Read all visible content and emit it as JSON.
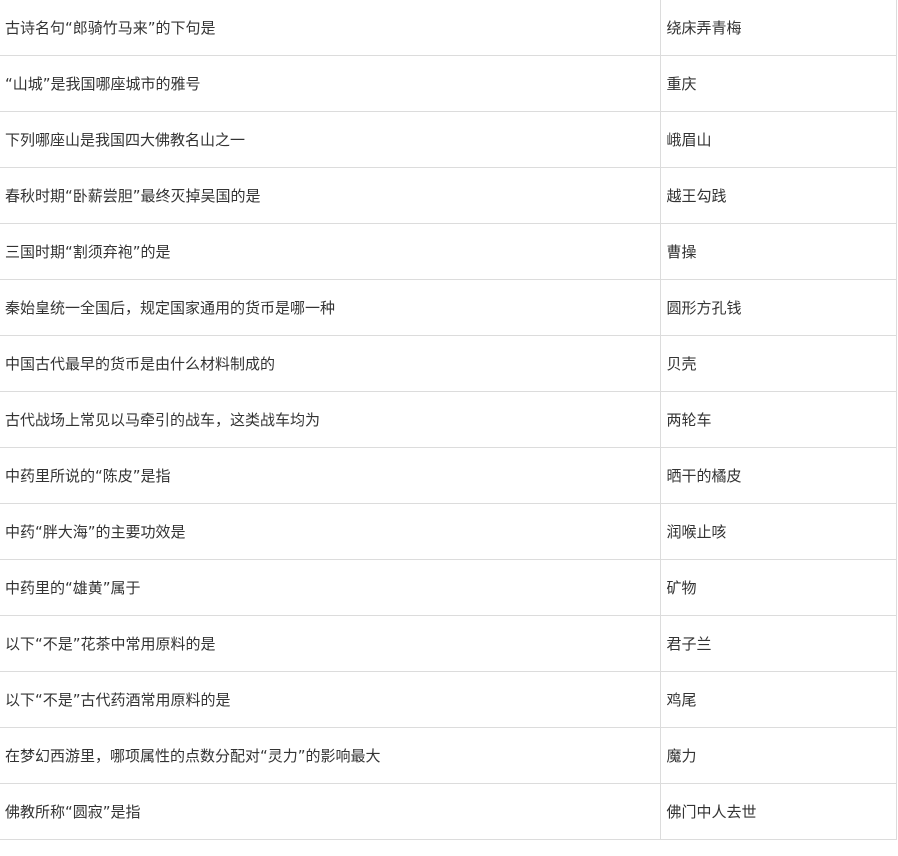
{
  "rows": [
    {
      "question": "古诗名句“郎骑竹马来”的下句是",
      "answer": "绕床弄青梅"
    },
    {
      "question": "“山城”是我国哪座城市的雅号",
      "answer": "重庆"
    },
    {
      "question": "下列哪座山是我国四大佛教名山之一",
      "answer": "峨眉山"
    },
    {
      "question": "春秋时期“卧薪尝胆”最终灭掉吴国的是",
      "answer": "越王勾践"
    },
    {
      "question": "三国时期“割须弃袍”的是",
      "answer": "曹操"
    },
    {
      "question": "秦始皇统一全国后，规定国家通用的货币是哪一种",
      "answer": "圆形方孔钱"
    },
    {
      "question": "中国古代最早的货币是由什么材料制成的",
      "answer": "贝壳"
    },
    {
      "question": "古代战场上常见以马牵引的战车，这类战车均为",
      "answer": "两轮车"
    },
    {
      "question": "中药里所说的“陈皮”是指",
      "answer": "晒干的橘皮"
    },
    {
      "question": "中药“胖大海”的主要功效是",
      "answer": "润喉止咳"
    },
    {
      "question": "中药里的“雄黄”属于",
      "answer": "矿物"
    },
    {
      "question": "以下“不是”花茶中常用原料的是",
      "answer": "君子兰"
    },
    {
      "question": "以下“不是”古代药酒常用原料的是",
      "answer": "鸡尾"
    },
    {
      "question": "在梦幻西游里，哪项属性的点数分配对“灵力”的影响最大",
      "answer": "魔力"
    },
    {
      "question": "佛教所称“圆寂”是指",
      "answer": "佛门中人去世"
    }
  ]
}
